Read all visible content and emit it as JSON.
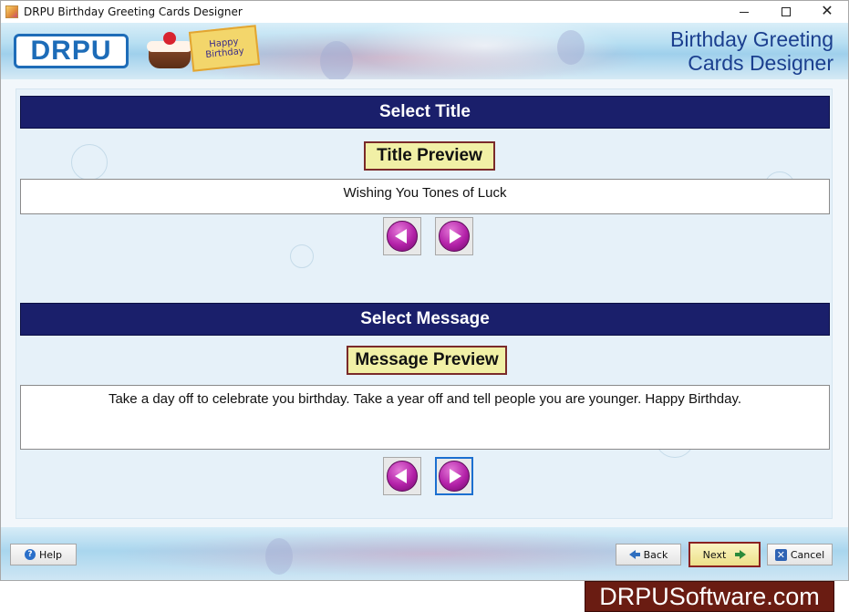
{
  "window": {
    "title": "DRPU Birthday Greeting Cards Designer",
    "minimize_symbol": "",
    "close_symbol": "✕"
  },
  "header": {
    "logo_text": "DRPU",
    "card_text": "Happy Birthday",
    "product_title_line1": "Birthday Greeting",
    "product_title_line2": "Cards Designer"
  },
  "title_section": {
    "heading": "Select Title",
    "preview_label": "Title Preview",
    "preview_text": "Wishing You Tones of Luck"
  },
  "message_section": {
    "heading": "Select Message",
    "preview_label": "Message Preview",
    "preview_text": "Take a day off to celebrate you birthday. Take a year off and tell people you are younger. Happy Birthday."
  },
  "footer": {
    "help_label": "Help",
    "back_label": "Back",
    "next_label": "Next",
    "cancel_label": "Cancel"
  },
  "watermark": {
    "text": "DRPUSoftware.com"
  },
  "colors": {
    "section_bar": "#1a1f6b",
    "preview_label_bg": "#f1f0a6",
    "nav_button": "#b321a8",
    "next_border": "#8a2222",
    "watermark_bg": "#6a1c12"
  },
  "icons": [
    "app-icon",
    "help-icon",
    "back-arrow-icon",
    "next-arrow-icon",
    "cancel-x-icon",
    "previous-arrow-icon",
    "forward-arrow-icon"
  ]
}
